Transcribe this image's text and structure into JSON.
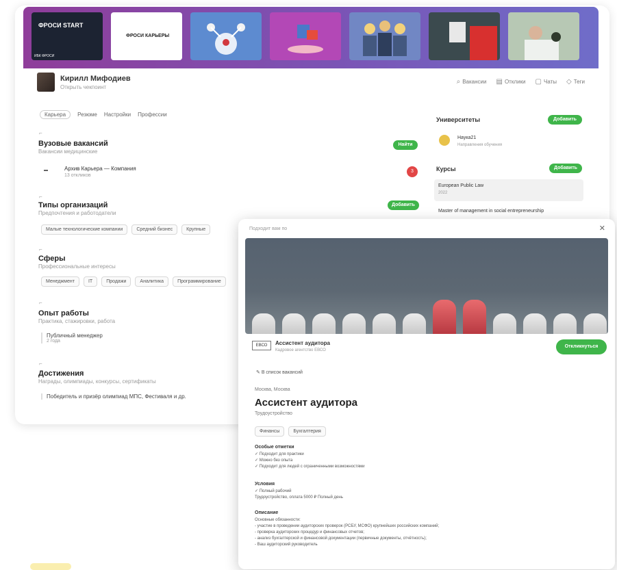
{
  "banner": {
    "tiles": [
      {
        "title": "ФРОСИ START",
        "caption": "ИБК ФРОСИ",
        "bg": "#1c2332"
      },
      {
        "title": "ФРОСИ КАРЬЕРЫ",
        "caption": "",
        "bg": "#ffffff"
      },
      {
        "title": "",
        "caption": "",
        "bg": "#5d8bd0"
      },
      {
        "title": "",
        "caption": "",
        "bg": "#b348b6"
      },
      {
        "title": "",
        "caption": "",
        "bg": "#7187c4"
      },
      {
        "title": "",
        "caption": "",
        "bg": "#3b4a4e"
      },
      {
        "title": "",
        "caption": "",
        "bg": "#b7c8b4"
      }
    ]
  },
  "header": {
    "name": "Кирилл Мифодиев",
    "subtitle": "Открыть чекпоинт",
    "actions": [
      "Вакансии",
      "Отклики",
      "Чаты",
      "Теги"
    ]
  },
  "tabs": [
    "Карьера",
    "Резюме",
    "Настройки",
    "Профессии"
  ],
  "sections": {
    "vacancies": {
      "title": "Вузовые вакансий",
      "subtitle": "Вакансии медицинские",
      "button": "Найти",
      "item_title": "Архив Карьера — Компания",
      "item_sub": "13 откликов",
      "badge": "3"
    },
    "org_types": {
      "title": "Типы организаций",
      "subtitle": "Предпочтения и работодатели",
      "button": "Добавить",
      "chips": [
        "Малые технологические компании",
        "Средний бизнес",
        "Крупные"
      ]
    },
    "spheres": {
      "title": "Сферы",
      "subtitle": "Профессиональные интересы",
      "chips": [
        "Менеджмент",
        "IT",
        "Продажи",
        "Аналитика",
        "Программирование"
      ]
    },
    "experience": {
      "title": "Опыт работы",
      "subtitle": "Практика, стажировки, работа",
      "item_title": "Публичный менеджер",
      "item_sub": "2 года"
    },
    "achievements": {
      "title": "Достижения",
      "subtitle": "Награды, олимпиады, конкурсы, сертификаты",
      "item_title": "Победитель и призёр олимпиад МПС, Фестиваля и др."
    }
  },
  "right": {
    "universities_label": "Университеты",
    "universities_button": "Добавить",
    "university_name": "Наука21",
    "university_sub": "Направления обучения",
    "courses_label": "Курсы",
    "courses_button": "Добавить",
    "course1_title": "European Public Law",
    "course1_sub": "2022",
    "course2_title": "Master of management in social entrepreneurship"
  },
  "popup": {
    "top_title": "Подходит вам по",
    "company_logo": "ЕВСО",
    "company_name": "Ассистент аудитора",
    "company_sub": "Кадровое агентство ЕВСО",
    "apply_button": "Откликнуться",
    "favorite": "В список вакансий",
    "city": "Москва, Москва",
    "title": "Ассистент аудитора",
    "type": "Трудоустройство",
    "tags": [
      "Финансы",
      "Бухгалтерия"
    ],
    "notes_title": "Особые отметки",
    "notes": [
      "✓ Подходит для практики",
      "✓ Можно без опыта",
      "✓ Подходит для людей с ограниченными возможностями"
    ],
    "conditions_title": "Условия",
    "conditions": [
      "✓ Полный рабочий",
      "Трудоустройство, оплата 5000 ₽ Полный день"
    ],
    "duties_title": "Описание",
    "duties_intro": "Основные обязанности:",
    "duties": [
      "- участие в проведении аудиторских проверок (РСБУ, МСФО) крупнейших российских компаний;",
      "- проверка аудиторских процедур и финансовых отчетов;",
      "- анализ бухгалтерской и финансовой документации (первичные документы, отчётность);",
      "- Ваш аудиторский руководитель"
    ]
  }
}
